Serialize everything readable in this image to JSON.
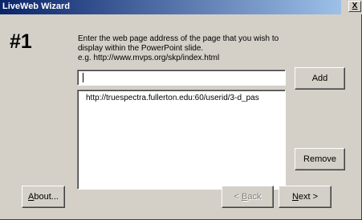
{
  "window": {
    "title": "LiveWeb Wizard",
    "close_glyph": "X"
  },
  "step": {
    "label": "#1"
  },
  "instructions": {
    "line1": "Enter the web page address of the page that you wish to",
    "line2": "display within the PowerPoint slide.",
    "line3": "e.g. http://www.mvps.org/skp/index.html"
  },
  "url_input": {
    "value": ""
  },
  "url_list": {
    "items": [
      "http://truespectra.fullerton.edu:60/userid/3-d_pas"
    ]
  },
  "buttons": {
    "add": "Add",
    "remove": "Remove",
    "about_mnemonic": "A",
    "about_rest": "bout...",
    "back_prefix": "< ",
    "back_mnemonic": "B",
    "back_rest": "ack",
    "next_mnemonic": "N",
    "next_rest": "ext >"
  }
}
